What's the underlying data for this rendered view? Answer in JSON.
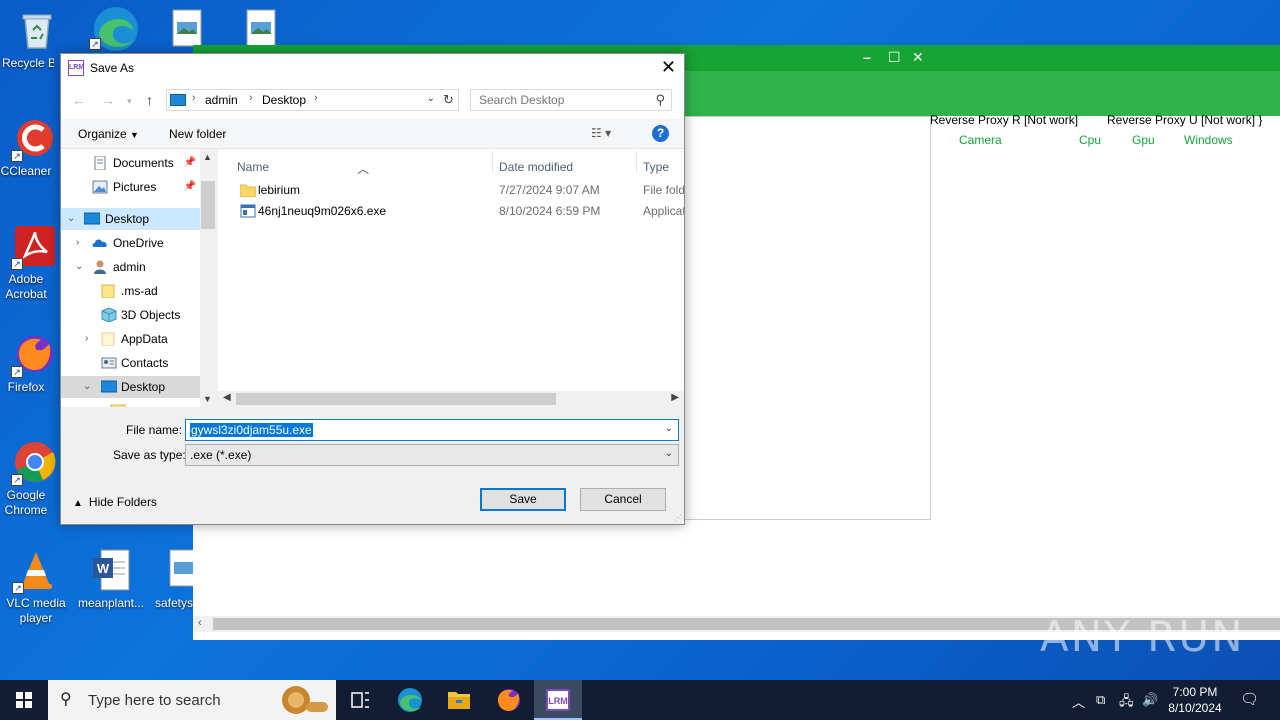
{
  "desktop": {
    "icons": [
      {
        "label": "Recycle Bin"
      },
      {
        "label": "CCleaner"
      },
      {
        "label": "Adobe Acrobat"
      },
      {
        "label": "Firefox"
      },
      {
        "label": "Google Chrome"
      },
      {
        "label": "VLC media player"
      },
      {
        "label": "meanplant..."
      },
      {
        "label": "safetyst..."
      }
    ]
  },
  "bg_app": {
    "menu_row1": [
      "Reverse Proxy R [Not work]",
      "Reverse Proxy U [Not work] }"
    ],
    "menu_row2": [
      "Camera",
      "Cpu",
      "Gpu",
      "Windows"
    ],
    "accent": "#17a434"
  },
  "dialog": {
    "title": "Save As",
    "app_icon_text": "LRM",
    "breadcrumb": [
      "admin",
      "Desktop"
    ],
    "search_placeholder": "Search Desktop",
    "organize_label": "Organize",
    "new_folder_label": "New folder",
    "nav_items": [
      {
        "label": "Documents",
        "icon": "documents-icon"
      },
      {
        "label": "Pictures",
        "icon": "pictures-icon"
      },
      {
        "label": "Desktop",
        "icon": "desktop-icon"
      },
      {
        "label": "OneDrive",
        "icon": "onedrive-icon"
      },
      {
        "label": "admin",
        "icon": "user-icon"
      },
      {
        "label": ".ms-ad",
        "icon": "folder-icon"
      },
      {
        "label": "3D Objects",
        "icon": "3d-objects-icon"
      },
      {
        "label": "AppData",
        "icon": "folder-icon"
      },
      {
        "label": "Contacts",
        "icon": "contacts-icon"
      },
      {
        "label": "Desktop",
        "icon": "desktop-icon"
      }
    ],
    "columns": {
      "name": "Name",
      "date": "Date modified",
      "type": "Type"
    },
    "files": [
      {
        "name": "lebirium",
        "date": "7/27/2024 9:07 AM",
        "type": "File fold",
        "icon": "folder-icon"
      },
      {
        "name": "46nj1neuq9m026x6.exe",
        "date": "8/10/2024 6:59 PM",
        "type": "Applicat",
        "icon": "exe-icon"
      }
    ],
    "file_name_label": "File name:",
    "file_name_value": "gywsl3zi0djam55u.exe",
    "save_type_label": "Save as type:",
    "save_type_value": ".exe (*.exe)",
    "hide_folders_label": "Hide Folders",
    "save_label": "Save",
    "cancel_label": "Cancel"
  },
  "taskbar": {
    "search_placeholder": "Type here to search",
    "time": "7:00 PM",
    "date": "8/10/2024"
  },
  "watermark": "ANY RUN"
}
